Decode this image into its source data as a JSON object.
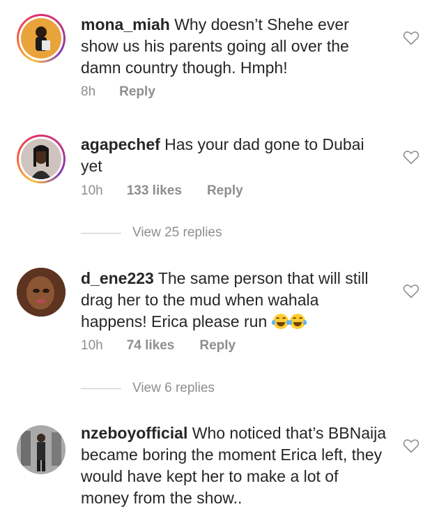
{
  "comments": [
    {
      "username": "mona_miah",
      "text": "Why doesn’t Shehe ever show us his parents going all over the damn country though. Hmph!",
      "time": "8h",
      "likes": "",
      "reply_label": "Reply"
    },
    {
      "username": "agapechef",
      "text": "Has your dad gone to Dubai yet",
      "time": "10h",
      "likes": "133 likes",
      "reply_label": "Reply",
      "view_replies": "View 25 replies"
    },
    {
      "username": "d_ene223",
      "text": "The same person that will still drag her to the mud when wahala happens! Erica please run",
      "emoji": "😂😂",
      "time": "10h",
      "likes": "74 likes",
      "reply_label": "Reply",
      "view_replies": "View 6 replies"
    },
    {
      "username": "nzeboyofficial",
      "text": "Who noticed that’s BBNaija became boring the moment Erica left, they would have kept her to make a lot of money from the show..",
      "time": "",
      "likes": "",
      "reply_label": ""
    }
  ],
  "icons": {
    "like": "heart-outline-icon"
  },
  "colors": {
    "text": "#262626",
    "meta": "#8e8e8e",
    "ring": "#e1306c"
  }
}
